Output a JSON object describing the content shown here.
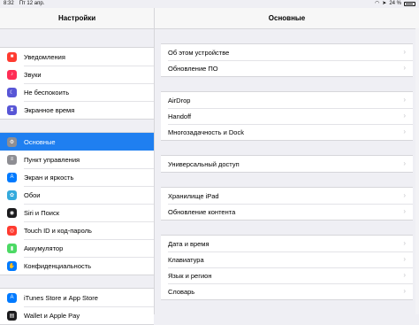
{
  "status_bar": {
    "time": "8:32",
    "date": "Пт 12 апр.",
    "battery": "24 %"
  },
  "sidebar": {
    "title": "Настройки",
    "groups": [
      {
        "items": [
          {
            "label": "Уведомления",
            "icon": "notifications-icon",
            "color": "#ff3b30",
            "glyph": "■"
          },
          {
            "label": "Звуки",
            "icon": "sounds-icon",
            "color": "#ff2d55",
            "glyph": "♪"
          },
          {
            "label": "Не беспокоить",
            "icon": "do-not-disturb-icon",
            "color": "#5856d6",
            "glyph": "☾"
          },
          {
            "label": "Экранное время",
            "icon": "screen-time-icon",
            "color": "#5856d6",
            "glyph": "⧗"
          }
        ]
      },
      {
        "items": [
          {
            "label": "Основные",
            "icon": "gear-icon",
            "color": "#8e8e93",
            "glyph": "⚙",
            "active": true
          },
          {
            "label": "Пункт управления",
            "icon": "control-center-icon",
            "color": "#8e8e93",
            "glyph": "≡"
          },
          {
            "label": "Экран и яркость",
            "icon": "display-brightness-icon",
            "color": "#007aff",
            "glyph": "A"
          },
          {
            "label": "Обои",
            "icon": "wallpaper-icon",
            "color": "#34aadc",
            "glyph": "✿"
          },
          {
            "label": "Siri и Поиск",
            "icon": "siri-icon",
            "color": "#1c1c1e",
            "glyph": "◉"
          },
          {
            "label": "Touch ID и код-пароль",
            "icon": "touch-id-icon",
            "color": "#ff3b30",
            "glyph": "◎"
          },
          {
            "label": "Аккумулятор",
            "icon": "battery-icon",
            "color": "#4cd964",
            "glyph": "▮"
          },
          {
            "label": "Конфиденциальность",
            "icon": "privacy-hand-icon",
            "color": "#007aff",
            "glyph": "✋"
          }
        ]
      },
      {
        "items": [
          {
            "label": "iTunes Store и App Store",
            "icon": "app-store-icon",
            "color": "#007aff",
            "glyph": "A"
          },
          {
            "label": "Wallet и Apple Pay",
            "icon": "wallet-icon",
            "color": "#1c1c1e",
            "glyph": "▤"
          }
        ]
      }
    ]
  },
  "main": {
    "title": "Основные",
    "chevron": "›",
    "groups": [
      {
        "items": [
          "Об этом устройстве",
          "Обновление ПО"
        ]
      },
      {
        "items": [
          "AirDrop",
          "Handoff",
          "Многозадачность и Dock"
        ]
      },
      {
        "items": [
          "Универсальный доступ"
        ]
      },
      {
        "items": [
          "Хранилище iPad",
          "Обновление контента"
        ]
      },
      {
        "items": [
          "Дата и время",
          "Клавиатура",
          "Язык и регион",
          "Словарь"
        ]
      }
    ]
  }
}
